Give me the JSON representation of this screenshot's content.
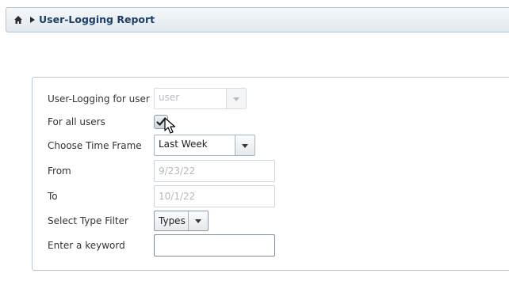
{
  "breadcrumb": {
    "home_icon": "home-icon",
    "separator_icon": "triangle-right-icon",
    "title": "User-Logging Report"
  },
  "form": {
    "user": {
      "label": "User-Logging for user",
      "value": "user",
      "disabled": true
    },
    "all_users": {
      "label": "For all users",
      "checked": true
    },
    "time_frame": {
      "label": "Choose Time Frame",
      "value": "Last Week"
    },
    "from": {
      "label": "From",
      "value": "9/23/22"
    },
    "to": {
      "label": "To",
      "value": "10/1/22"
    },
    "type_filter": {
      "label": "Select Type Filter",
      "value": "Types"
    },
    "keyword": {
      "label": "Enter a keyword",
      "value": ""
    }
  },
  "colors": {
    "title": "#1d3f66",
    "border": "#b6c4cf",
    "disabled_text": "#b4b9be"
  }
}
